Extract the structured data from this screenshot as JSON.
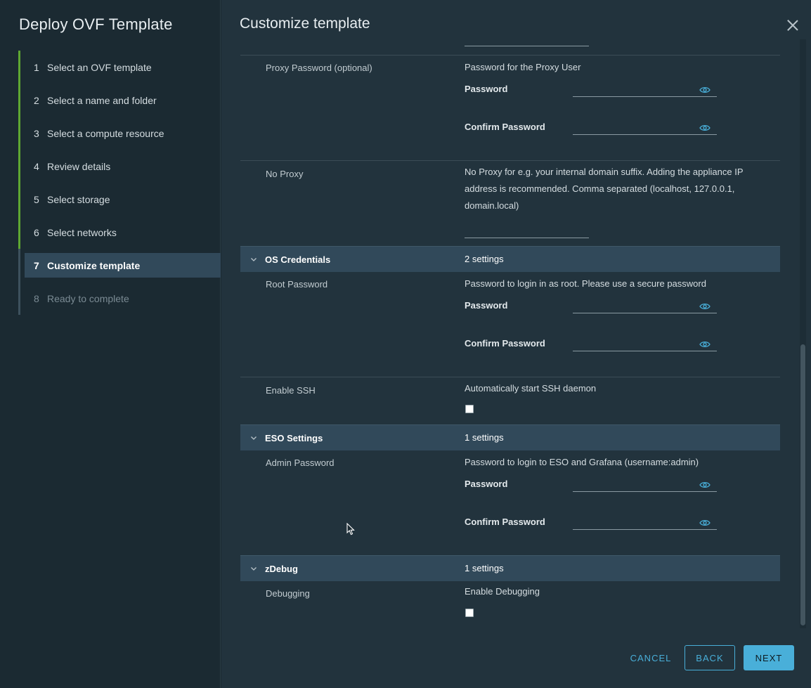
{
  "wizard": {
    "title": "Deploy OVF Template",
    "steps": [
      {
        "num": "1",
        "label": "Select an OVF template"
      },
      {
        "num": "2",
        "label": "Select a name and folder"
      },
      {
        "num": "3",
        "label": "Select a compute resource"
      },
      {
        "num": "4",
        "label": "Review details"
      },
      {
        "num": "5",
        "label": "Select storage"
      },
      {
        "num": "6",
        "label": "Select networks"
      },
      {
        "num": "7",
        "label": "Customize template"
      },
      {
        "num": "8",
        "label": "Ready to complete"
      }
    ],
    "active_step": 7
  },
  "main": {
    "title": "Customize template",
    "proxy_password": {
      "label": "Proxy Password (optional)",
      "description": "Password for the Proxy User",
      "password_label": "Password",
      "confirm_label": "Confirm Password"
    },
    "no_proxy": {
      "label": "No Proxy",
      "description": "No Proxy for e.g. your internal domain suffix. Adding the appliance IP address is recommended. Comma separated (localhost, 127.0.0.1, domain.local)"
    },
    "os_credentials": {
      "name": "OS Credentials",
      "count": "2 settings",
      "root_password": {
        "label": "Root Password",
        "description": "Password to login in as root. Please use a secure password",
        "password_label": "Password",
        "confirm_label": "Confirm Password"
      },
      "enable_ssh": {
        "label": "Enable SSH",
        "description": "Automatically start SSH daemon",
        "checked": false
      }
    },
    "eso_settings": {
      "name": "ESO Settings",
      "count": "1 settings",
      "admin_password": {
        "label": "Admin Password",
        "description": "Password to login to ESO and Grafana (username:admin)",
        "password_label": "Password",
        "confirm_label": "Confirm Password"
      }
    },
    "zdebug": {
      "name": "zDebug",
      "count": "1 settings",
      "debugging": {
        "label": "Debugging",
        "description": "Enable Debugging",
        "checked": false
      }
    }
  },
  "footer": {
    "cancel": "CANCEL",
    "back": "BACK",
    "next": "NEXT"
  },
  "colors": {
    "accent": "#49afd9",
    "step_done": "#5ea732",
    "section_bg": "#31495a"
  },
  "icons": [
    "close-icon",
    "eye-icon",
    "chevron-down-icon",
    "mouse-cursor-icon"
  ]
}
